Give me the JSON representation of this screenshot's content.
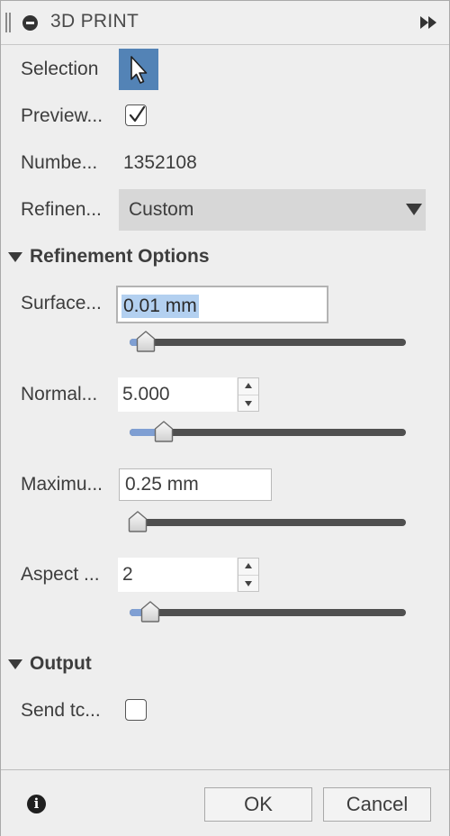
{
  "title": "3D PRINT",
  "selection": {
    "label": "Selection"
  },
  "preview": {
    "label": "Preview...",
    "checked": true
  },
  "number": {
    "label": "Numbe...",
    "value": "1352108"
  },
  "refinement": {
    "label": "Refinen...",
    "value": "Custom"
  },
  "refinement_options": {
    "header": "Refinement Options",
    "surface": {
      "label": "Surface...",
      "value": "0.01 mm",
      "slider": 0.03
    },
    "normal": {
      "label": "Normal...",
      "value": "5.000",
      "slider": 0.1
    },
    "maximum": {
      "label": "Maximu...",
      "value": "0.25 mm",
      "slider": 0.0
    },
    "aspect": {
      "label": "Aspect ...",
      "value": "2",
      "slider": 0.05
    }
  },
  "output": {
    "header": "Output",
    "send": {
      "label": "Send tc...",
      "checked": false
    }
  },
  "footer": {
    "ok_label": "OK",
    "cancel_label": "Cancel"
  },
  "colors": {
    "accent": "#5383b6",
    "selection_highlight": "#b3d0f0",
    "slider_fill": "#7f9fd3"
  }
}
